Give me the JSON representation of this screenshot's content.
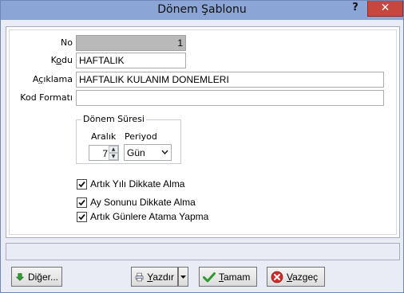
{
  "window": {
    "title": "Dönem Şablonu",
    "help_label": "?",
    "close_label": "✕"
  },
  "form": {
    "no_label": "No",
    "no_value": "1",
    "kodu_label_pre": "K",
    "kodu_label_ul": "o",
    "kodu_label_post": "du",
    "kodu_value": "HAFTALIK",
    "aciklama_label_pre": "A",
    "aciklama_label_ul": "ç",
    "aciklama_label_post": "ıklama",
    "aciklama_value": "HAFTALIK KULANIM DONEMLERI",
    "kod_formati_label": "Kod Formatı",
    "kod_formati_value": ""
  },
  "donem_suresi": {
    "title": "Dönem Süresi",
    "aralik_label": "Aralık",
    "periyod_label": "Periyod",
    "aralik_value": "7",
    "periyod_value": "Gün"
  },
  "checkboxes": [
    {
      "label": "Artık Yılı Dikkate Alma",
      "checked": true
    },
    {
      "label": "Ay Sonunu Dikkate Alma",
      "checked": true
    },
    {
      "label": "Artık Günlere Atama Yapma",
      "checked": true
    }
  ],
  "buttons": {
    "diger_pre": "Di",
    "diger_ul": "ğ",
    "diger_post": "er...",
    "yazdir_pre": "",
    "yazdir_ul": "Y",
    "yazdir_post": "azdır",
    "tamam_pre": "",
    "tamam_ul": "T",
    "tamam_post": "amam",
    "vazgec_pre": "",
    "vazgec_ul": "V",
    "vazgec_post": "azgeç"
  },
  "icons": {
    "diger": "green-down-arrow-icon",
    "yazdir": "printer-icon",
    "tamam": "green-check-icon",
    "vazgec": "red-x-circle-icon"
  },
  "colors": {
    "titlebar": "#8ba5d6",
    "close": "#c7463e",
    "disabled_field": "#b9b9b9"
  }
}
